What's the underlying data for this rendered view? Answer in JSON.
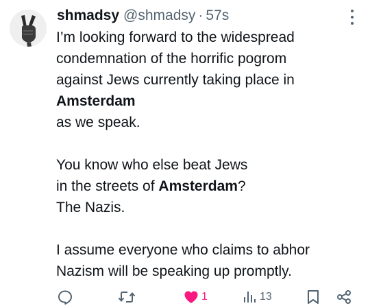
{
  "tweet": {
    "display_name": "shmadsy",
    "handle": "@shmadsy",
    "separator": "·",
    "time": "57s",
    "body": {
      "p1_l1": "I’m looking forward to the widespread",
      "p1_l2": "condemnation of the horrific pogrom",
      "p1_l3": "against Jews currently taking place in",
      "p1_l4": "Amsterdam",
      "p1_l5": "as we speak.",
      "p2_l1": "You know who else beat Jews",
      "p2_l2_pre": "in the streets of ",
      "p2_l2_bold": "Amsterdam",
      "p2_l2_post": "?",
      "p2_l3": "The Nazis.",
      "p3_l1": "I assume everyone who claims to abhor",
      "p3_l2": "Nazism will be speaking up promptly."
    },
    "actions": {
      "likes": "1",
      "views": "13"
    },
    "colors": {
      "like_active": "#f91880",
      "secondary_text": "#536471"
    },
    "icons": {
      "avatar": "peace-sign-hand-icon",
      "more": "more-vertical-icon",
      "reply": "reply-icon",
      "retweet": "retweet-icon",
      "like": "heart-filled-icon",
      "views": "views-chart-icon",
      "bookmark": "bookmark-icon",
      "share": "share-icon"
    }
  }
}
